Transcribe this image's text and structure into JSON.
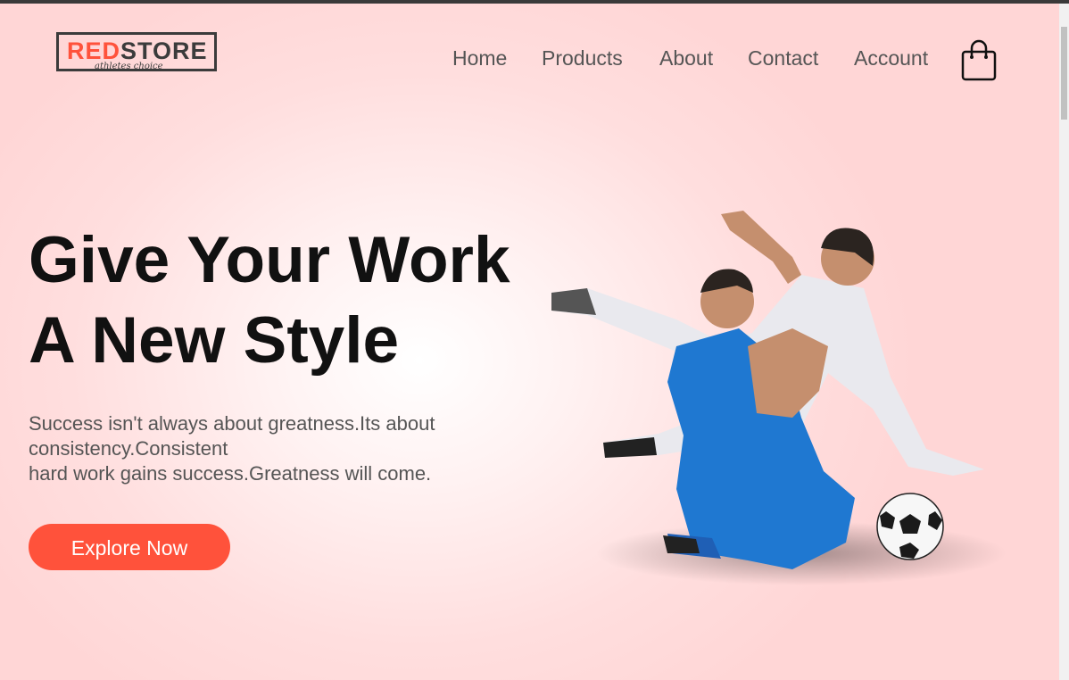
{
  "logo": {
    "word_red": "RED",
    "word_dark": "STORE",
    "tagline": "athletes choice"
  },
  "nav": {
    "items": [
      "Home",
      "Products",
      "About",
      "Contact",
      "Account"
    ]
  },
  "hero": {
    "headline_line1": "Give Your Work",
    "headline_line2": "A New Style",
    "body_line1": "Success isn't always about greatness.Its about consistency.Consistent",
    "body_line2": "hard work gains success.Greatness will come.",
    "cta_label": "Explore Now"
  },
  "icons": {
    "cart": "shopping-bag-icon",
    "hero_image": "football-players-image"
  },
  "colors": {
    "accent": "#ff523b",
    "background": "#ffdede",
    "headline": "#111111",
    "body": "#555555"
  }
}
